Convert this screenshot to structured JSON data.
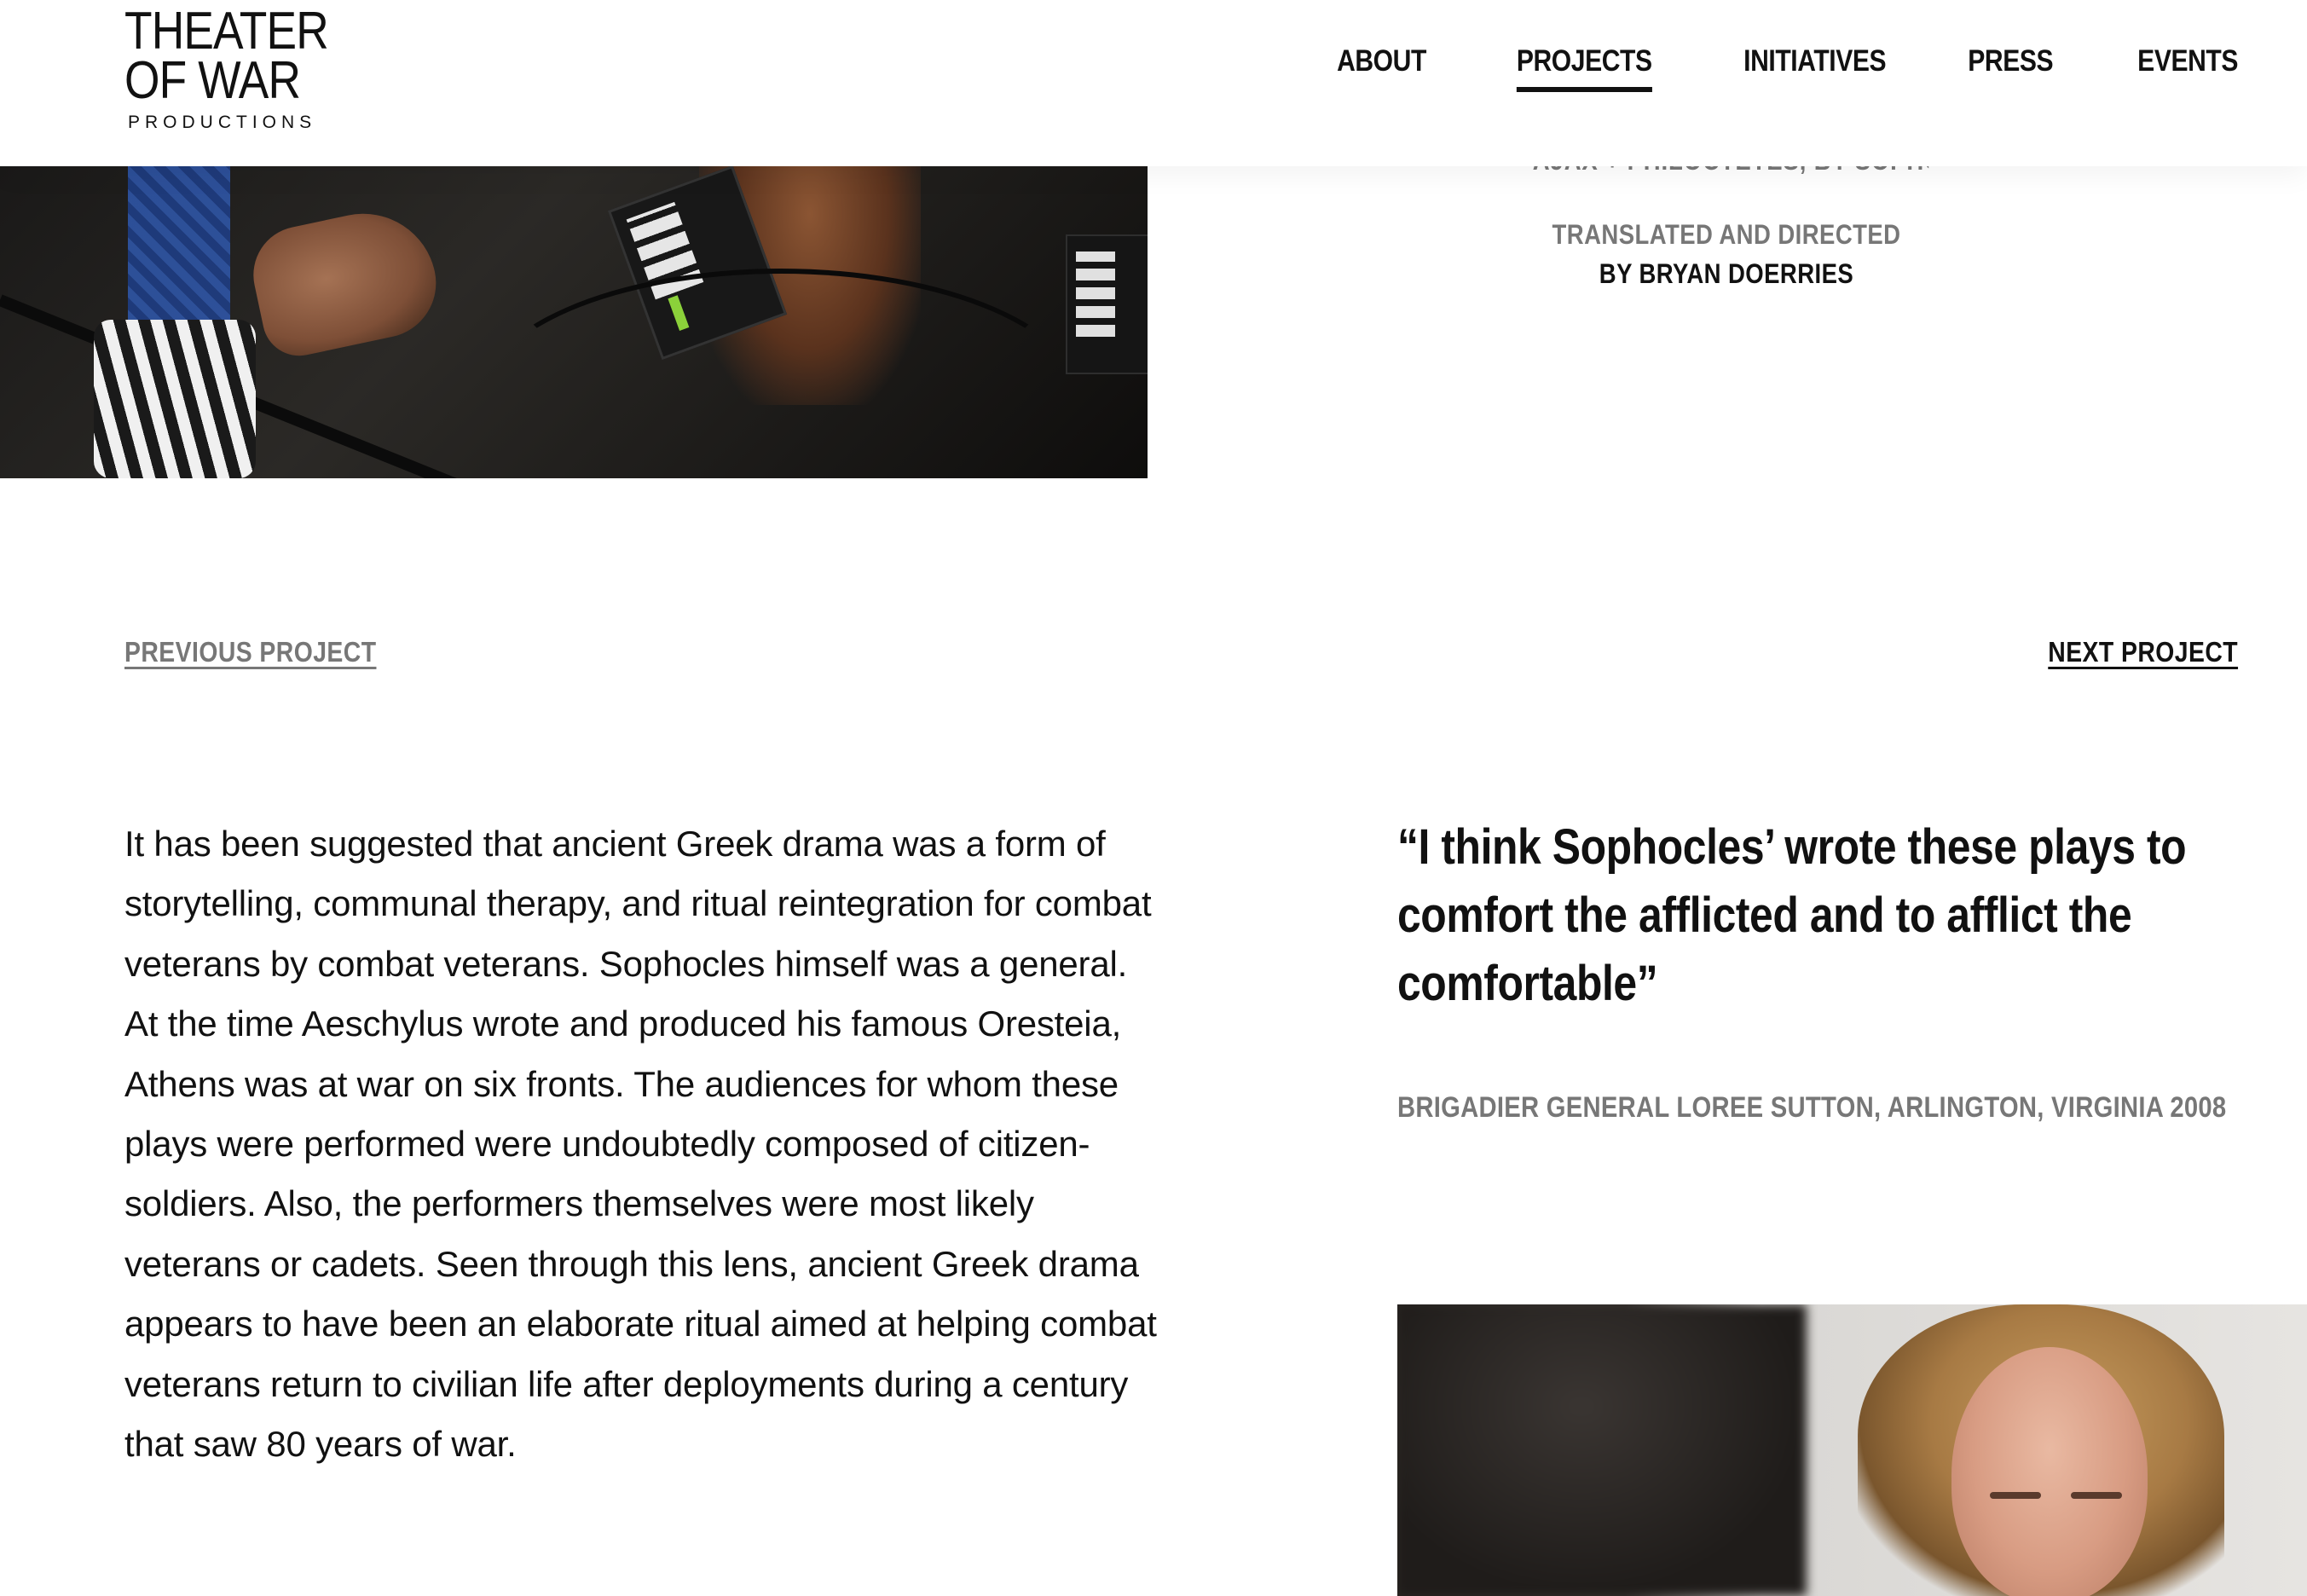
{
  "header": {
    "logo": {
      "line1": "THEATER",
      "line2": "OF WAR",
      "line3": "PRODUCTIONS"
    },
    "nav": [
      {
        "label": "ABOUT",
        "active": false
      },
      {
        "label": "PROJECTS",
        "active": true
      },
      {
        "label": "INITIATIVES",
        "active": false
      },
      {
        "label": "PRESS",
        "active": false
      },
      {
        "label": "EVENTS",
        "active": false
      }
    ]
  },
  "credit": {
    "cut_off_line": "AJAX + PHILOCTETES, BY SOPHOCLES",
    "line1": "TRANSLATED AND DIRECTED",
    "line2": "BY BRYAN DOERRIES"
  },
  "pagination": {
    "previous": "PREVIOUS PROJECT",
    "next": "NEXT PROJECT"
  },
  "body": {
    "paragraph": "It has been suggested that ancient Greek drama was a form of storytelling, communal therapy, and ritual reintegration for combat veterans by combat veterans. Sophocles himself was a general. At the time Aeschylus wrote and produced his famous Oresteia, Athens was at war on six fronts. The audiences for whom these plays were performed were undoubtedly composed of citizen-soldiers. Also, the performers themselves were most likely veterans or cadets. Seen through this lens, ancient Greek drama appears to have been an elaborate ritual aimed at helping combat veterans return to civilian life after deployments during a century that saw 80 years of war."
  },
  "quote": {
    "text": "“I think Sophocles’ wrote these plays to comfort the afflicted and to afflict the comfortable”",
    "attribution": "BRIGADIER GENERAL LOREE SUTTON, ARLINGTON, VIRGINIA 2008"
  },
  "colors": {
    "text": "#111111",
    "muted": "#777777",
    "background": "#ffffff"
  }
}
